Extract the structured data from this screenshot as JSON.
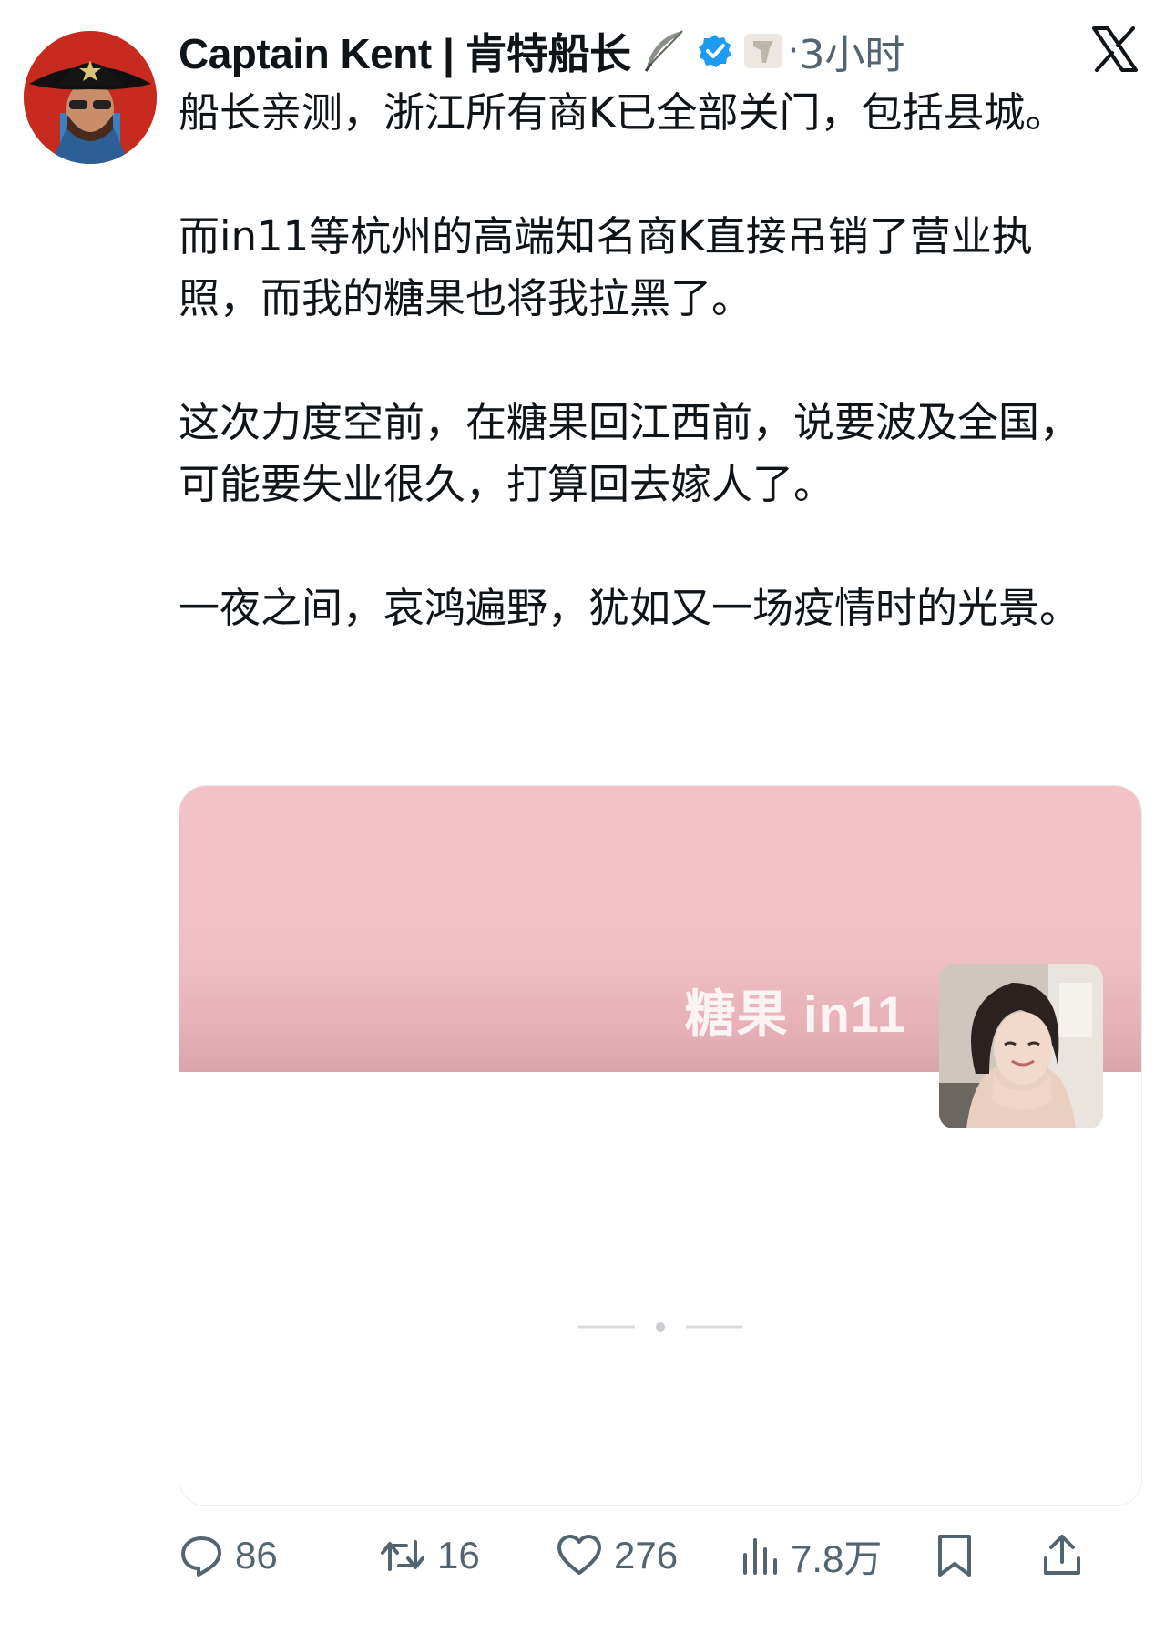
{
  "tweet": {
    "author": {
      "display_name": "Captain Kent | 肯特船长",
      "verified": true,
      "avatar_icon": "pirate-captain-avatar",
      "badge_icons": [
        "feather-icon",
        "verified-icon",
        "flag-icon"
      ]
    },
    "dot": "·",
    "timestamp": "3小时",
    "platform_logo": "x-logo",
    "paragraphs": [
      "船长亲测，浙江所有商K已全部关门，包括县城。",
      "而in11等杭州的高端知名商K直接吊销了营业执照，而我的糖果也将我拉黑了。",
      "这次力度空前，在糖果回江西前，说要波及全国，可能要失业很久，打算回去嫁人了。",
      "一夜之间，哀鸿遍野，犹如又一场疫情时的光景。"
    ],
    "card": {
      "nickname": "糖果 in11",
      "banner_color": "#f2c2c8",
      "photo_icon": "profile-photo"
    },
    "actions": {
      "reply_count": "86",
      "repost_count": "16",
      "like_count": "276",
      "view_count": "7.8万"
    }
  },
  "colors": {
    "text": "#0f1419",
    "muted": "#536471",
    "verified": "#1d9bf0",
    "banner": "#f2c2c8"
  }
}
